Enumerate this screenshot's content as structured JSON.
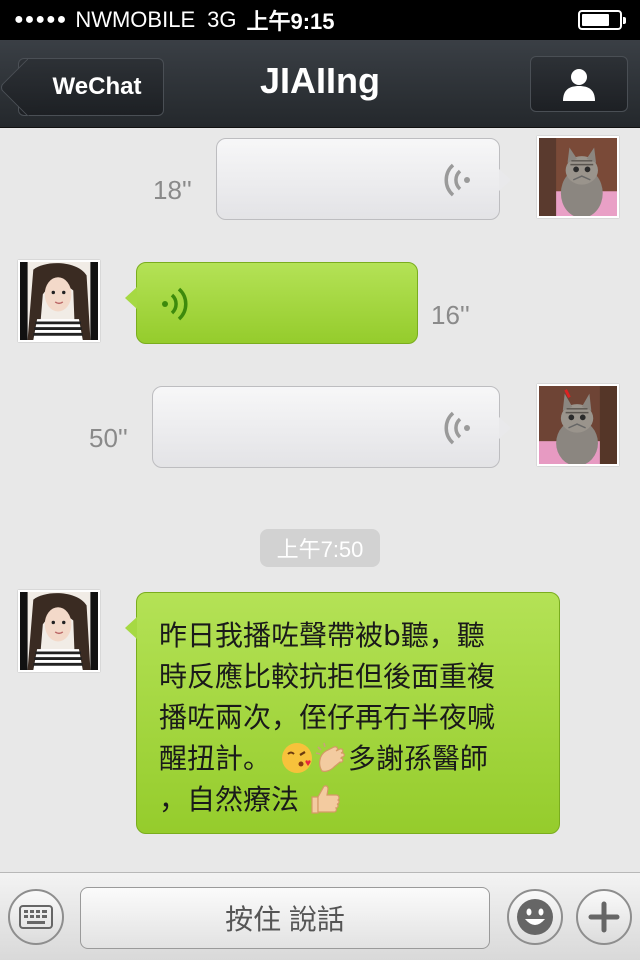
{
  "status_bar": {
    "signal": "●●●●●",
    "carrier": "NWMOBILE",
    "network": "3G",
    "time": "上午9:15",
    "battery_level": 0.75
  },
  "nav": {
    "back_label": "WeChat",
    "title": "JIAIIng",
    "profile_icon": "person-icon"
  },
  "messages": [
    {
      "type": "voice",
      "direction": "out",
      "duration": "18''"
    },
    {
      "type": "voice",
      "direction": "in",
      "duration": "16''"
    },
    {
      "type": "voice",
      "direction": "out",
      "duration": "50''"
    },
    {
      "type": "timestamp",
      "text": "上午7:50"
    },
    {
      "type": "text",
      "direction": "in",
      "lines": [
        "昨日我播咗聲帶被b聽，聽",
        "時反應比較抗拒但後面重複",
        "播咗兩次，侄仔再冇半夜喊",
        "醒扭計。",
        "多謝孫醫師",
        "，自然療法"
      ],
      "emoji": [
        "kissing-face-emoji",
        "clapping-hands-emoji",
        "thumbs-up-emoji"
      ]
    }
  ],
  "bottom_bar": {
    "keyboard_icon": "keyboard-icon",
    "talk_label": "按住 說話",
    "emoji_icon": "smiley-icon",
    "add_icon": "plus-icon"
  },
  "colors": {
    "incoming_bubble": "#a6d943",
    "outgoing_bubble": "#e9e9eb",
    "nav_bg": "#2b2f34",
    "wave_green": "#3d8a0c",
    "wave_gray": "#9a9a9a"
  }
}
